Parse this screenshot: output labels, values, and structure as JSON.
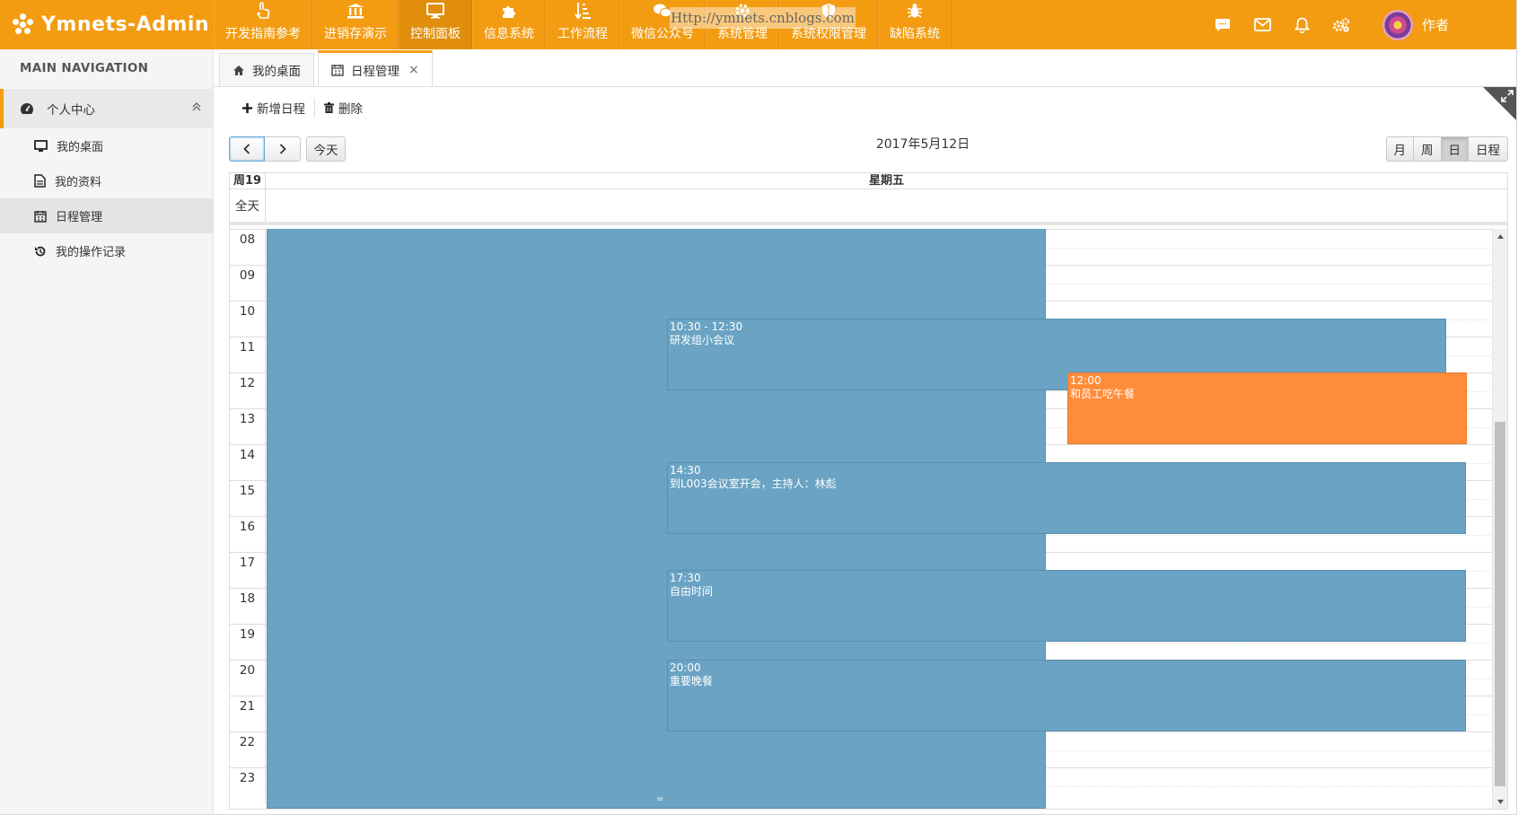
{
  "app": {
    "brand": "Ymnets-Admin",
    "watermark": "Http://ymnets.cnblogs.com"
  },
  "modules": [
    {
      "label": "开发指南参考",
      "icon": "hand-pointer-icon"
    },
    {
      "label": "进销存演示",
      "icon": "bank-icon"
    },
    {
      "label": "控制面板",
      "icon": "monitor-icon",
      "active": true
    },
    {
      "label": "信息系统",
      "icon": "puzzle-icon"
    },
    {
      "label": "工作流程",
      "icon": "sort-list-icon"
    },
    {
      "label": "微信公众号",
      "icon": "wechat-icon"
    },
    {
      "label": "系统管理",
      "icon": "gear-icon"
    },
    {
      "label": "系统权限管理",
      "icon": "shield-icon"
    },
    {
      "label": "缺陷系统",
      "icon": "bug-icon"
    }
  ],
  "topbar": {
    "user_name": "作者"
  },
  "sidebar": {
    "header": "MAIN NAVIGATION",
    "group": "个人中心",
    "items": [
      {
        "label": "我的桌面",
        "icon": "desktop-icon"
      },
      {
        "label": "我的资料",
        "icon": "document-icon"
      },
      {
        "label": "日程管理",
        "icon": "calendar-icon",
        "active": true
      },
      {
        "label": "我的操作记录",
        "icon": "history-icon"
      }
    ]
  },
  "tabs": [
    {
      "label": "我的桌面",
      "icon": "home-icon"
    },
    {
      "label": "日程管理",
      "icon": "calendar-icon",
      "active": true,
      "close": "×"
    }
  ],
  "toolbar": {
    "add": "新增日程",
    "delete": "删除"
  },
  "calendar": {
    "today_label": "今天",
    "date_title": "2017年5月12日",
    "views": [
      "月",
      "周",
      "日",
      "日程"
    ],
    "active_view": "日",
    "week_label": "周19",
    "day_label": "星期五",
    "allday_label": "全天",
    "hours": [
      "08",
      "09",
      "10",
      "11",
      "12",
      "13",
      "14",
      "15",
      "16",
      "17",
      "18",
      "19",
      "20",
      "21",
      "22",
      "23"
    ],
    "events": [
      {
        "time": "10:30 - 12:30",
        "title": "研发组小会议",
        "color": "#6aa3c3"
      },
      {
        "time": "12:00",
        "title": "和员工吃午餐",
        "color": "#ff8c3a"
      },
      {
        "time": "14:30",
        "title": "到L003会议室开会，主持人：林彪",
        "color": "#6aa3c3"
      },
      {
        "time": "17:30",
        "title": "自由时间",
        "color": "#6aa3c3"
      },
      {
        "time": "20:00",
        "title": "重要晚餐",
        "color": "#6aa3c3"
      }
    ]
  },
  "colors": {
    "brand": "#f39c12",
    "event_blue": "#6aa3c3",
    "event_orange": "#ff8c3a"
  }
}
